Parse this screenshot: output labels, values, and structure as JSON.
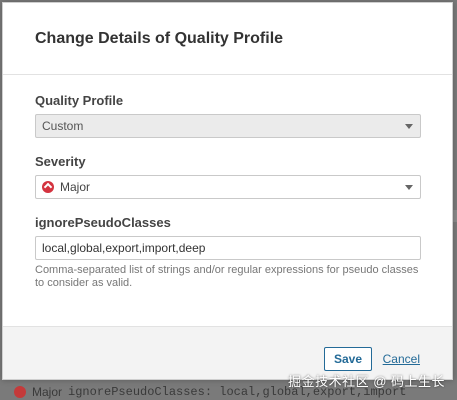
{
  "dialog": {
    "title": "Change Details of Quality Profile"
  },
  "quality_profile": {
    "label": "Quality Profile",
    "value": "Custom"
  },
  "severity": {
    "label": "Severity",
    "value": "Major",
    "icon": "major-severity-icon",
    "icon_color": "#d4333f"
  },
  "parameter": {
    "label": "ignorePseudoClasses",
    "value": "local,global,export,import,deep",
    "help": "Comma-separated list of strings and/or regular expressions for pseudo classes to consider as valid."
  },
  "footer": {
    "save_label": "Save",
    "cancel_label": "Cancel"
  },
  "background_row": {
    "severity": "Major",
    "text": "ignorePseudoClasses: local,global,export,import"
  },
  "watermark": "掘金技术社区 @ 码上生长",
  "colors": {
    "accent": "#236a97",
    "overlay": "#7a7a7a"
  }
}
